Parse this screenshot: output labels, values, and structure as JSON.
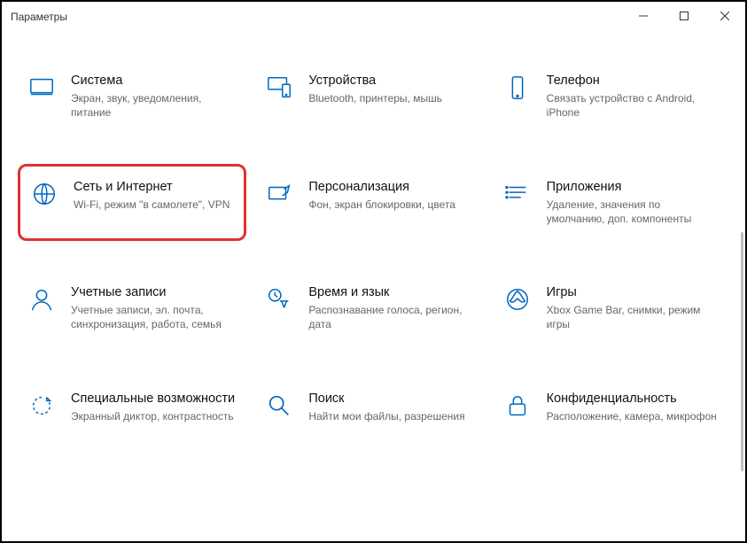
{
  "window": {
    "title": "Параметры"
  },
  "tiles": [
    {
      "id": "system",
      "title": "Система",
      "desc": "Экран, звук, уведомления, питание"
    },
    {
      "id": "devices",
      "title": "Устройства",
      "desc": "Bluetooth, принтеры, мышь"
    },
    {
      "id": "phone",
      "title": "Телефон",
      "desc": "Связать устройство с Android, iPhone"
    },
    {
      "id": "network",
      "title": "Сеть и Интернет",
      "desc": "Wi-Fi, режим \"в самолете\", VPN"
    },
    {
      "id": "personalization",
      "title": "Персонализация",
      "desc": "Фон, экран блокировки, цвета"
    },
    {
      "id": "apps",
      "title": "Приложения",
      "desc": "Удаление, значения по умолчанию, доп. компоненты"
    },
    {
      "id": "accounts",
      "title": "Учетные записи",
      "desc": "Учетные записи, эл. почта, синхронизация, работа, семья"
    },
    {
      "id": "time",
      "title": "Время и язык",
      "desc": "Распознавание голоса, регион, дата"
    },
    {
      "id": "gaming",
      "title": "Игры",
      "desc": "Xbox Game Bar, снимки, режим игры"
    },
    {
      "id": "ease",
      "title": "Специальные возможности",
      "desc": "Экранный диктор, контрастность"
    },
    {
      "id": "search",
      "title": "Поиск",
      "desc": "Найти мои файлы, разрешения"
    },
    {
      "id": "privacy",
      "title": "Конфиденциальность",
      "desc": "Расположение, камера, микрофон"
    }
  ]
}
